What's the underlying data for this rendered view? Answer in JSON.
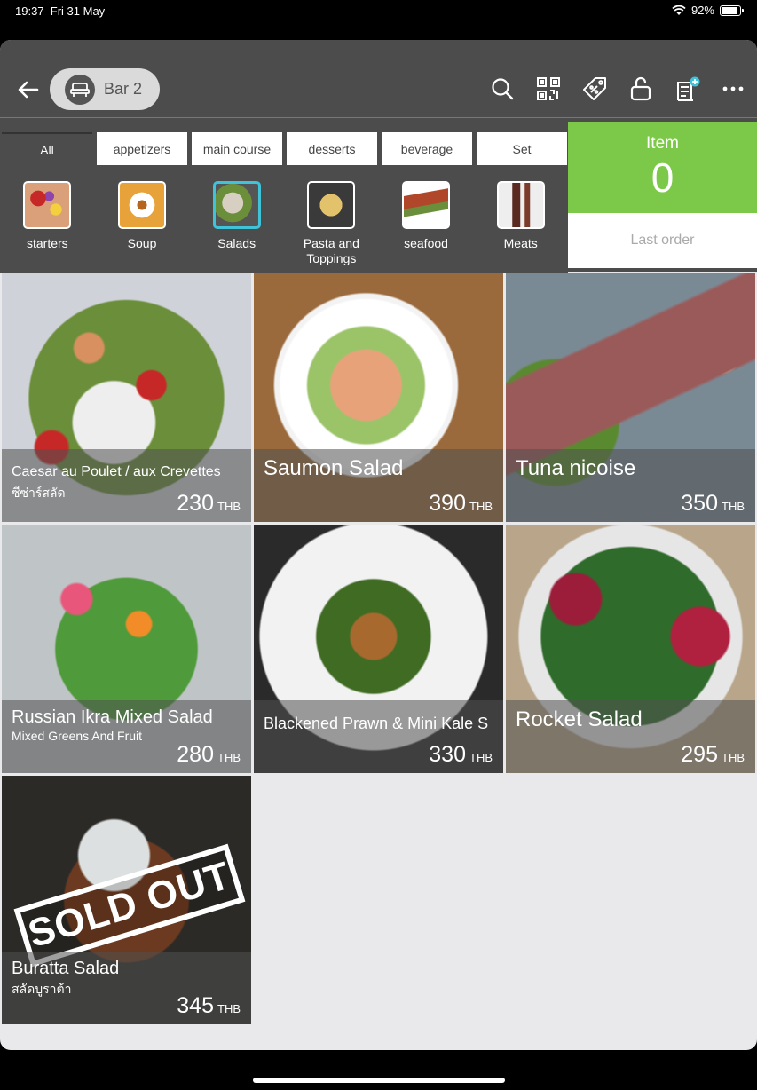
{
  "status": {
    "time": "19:37",
    "date": "Fri 31 May",
    "battery": "92%",
    "battery_level": 0.92
  },
  "header": {
    "table_name": "Bar 2"
  },
  "tools": [
    "search-icon",
    "qr-code-icon",
    "discount-tag-icon",
    "unlock-icon",
    "bill-add-icon",
    "more-icon"
  ],
  "tabs": [
    "All",
    "appetizers",
    "main course",
    "desserts",
    "beverage",
    "Set"
  ],
  "subcategories": [
    "starters",
    "Soup",
    "Salads",
    "Pasta and Toppings",
    "seafood",
    "Meats"
  ],
  "order": {
    "label": "Item",
    "count": "0",
    "last_order": "Last order"
  },
  "colors": {
    "accent_green": "#7cc94a",
    "selected_cyan": "#3ec3d8",
    "toolbar": "#4c4c4c"
  },
  "items": [
    {
      "name": "Caesar au Poulet / aux Crevettes",
      "sub": "ซีซ่าร์สลัด",
      "price": "230",
      "currency": "THB",
      "sold_out": false
    },
    {
      "name": "Saumon Salad",
      "sub": "",
      "price": "390",
      "currency": "THB",
      "sold_out": false
    },
    {
      "name": "Tuna nicoise",
      "sub": "",
      "price": "350",
      "currency": "THB",
      "sold_out": false
    },
    {
      "name": "Russian Ikra Mixed Salad",
      "sub": "Mixed Greens And Fruit",
      "price": "280",
      "currency": "THB",
      "sold_out": false
    },
    {
      "name": "Blackened Prawn & Mini Kale S",
      "sub": "",
      "price": "330",
      "currency": "THB",
      "sold_out": false
    },
    {
      "name": "Rocket Salad",
      "sub": "",
      "price": "295",
      "currency": "THB",
      "sold_out": false
    },
    {
      "name": "Buratta Salad",
      "sub": "สลัดบูราต้า",
      "price": "345",
      "currency": "THB",
      "sold_out": true,
      "sold_label": "SOLD OUT"
    }
  ]
}
